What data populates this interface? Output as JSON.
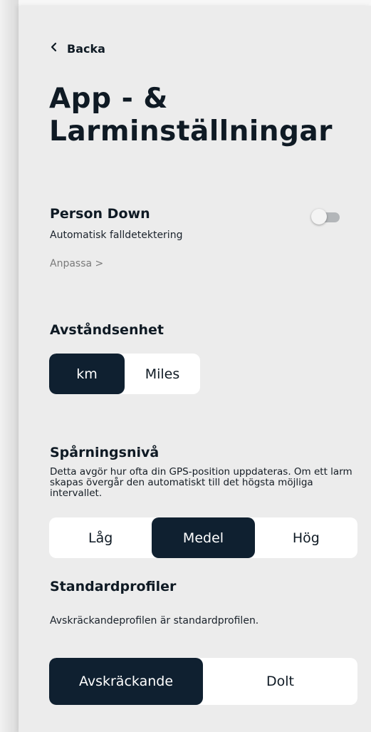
{
  "header": {
    "back_label": "Backa",
    "title": "App - & Larminställningar"
  },
  "person_down": {
    "title": "Person Down",
    "subtitle": "Automatisk falldetektering",
    "customize_link": "Anpassa >",
    "toggle_on": false
  },
  "distance_unit": {
    "title": "Avståndsenhet",
    "options": [
      "km",
      "Miles"
    ],
    "selected": "km"
  },
  "tracking_level": {
    "title": "Spårningsnivå",
    "description": "Detta avgör hur ofta din GPS-position uppdateras. Om ett larm skapas övergår den automatiskt till det högsta möjliga intervallet.",
    "options": [
      "Låg",
      "Medel",
      "Hög"
    ],
    "selected": "Medel"
  },
  "default_profiles": {
    "title": "Standardprofiler",
    "description": "Avskräckandeprofilen är standardprofilen.",
    "options": [
      "Avskräckande",
      "Dolt"
    ],
    "selected": "Avskräckande"
  },
  "colors": {
    "accent_dark": "#0f2030",
    "background": "#ececec",
    "toggle_off": "#b3b6b9"
  }
}
